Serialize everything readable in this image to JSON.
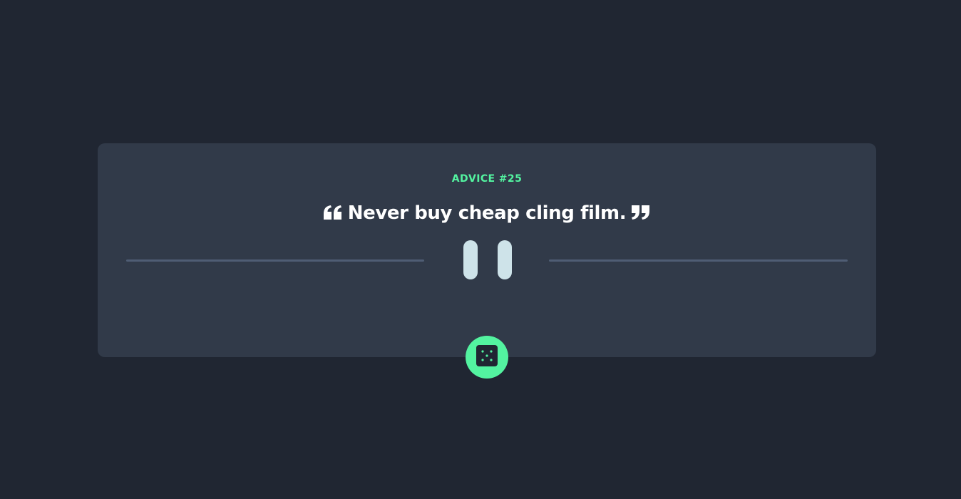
{
  "advice": {
    "label": "ADVICE #25",
    "quote": "Never buy cheap cling film."
  },
  "icons": {
    "open_quote": "open-quote-icon",
    "close_quote": "close-quote-icon",
    "divider_pause": "pause-icon",
    "dice": "dice-icon"
  },
  "colors": {
    "background": "#202632",
    "card": "#313a49",
    "accent": "#53f3a0",
    "text": "#ffffff",
    "divider": "#4f5d74",
    "pause": "#cee3e9"
  }
}
